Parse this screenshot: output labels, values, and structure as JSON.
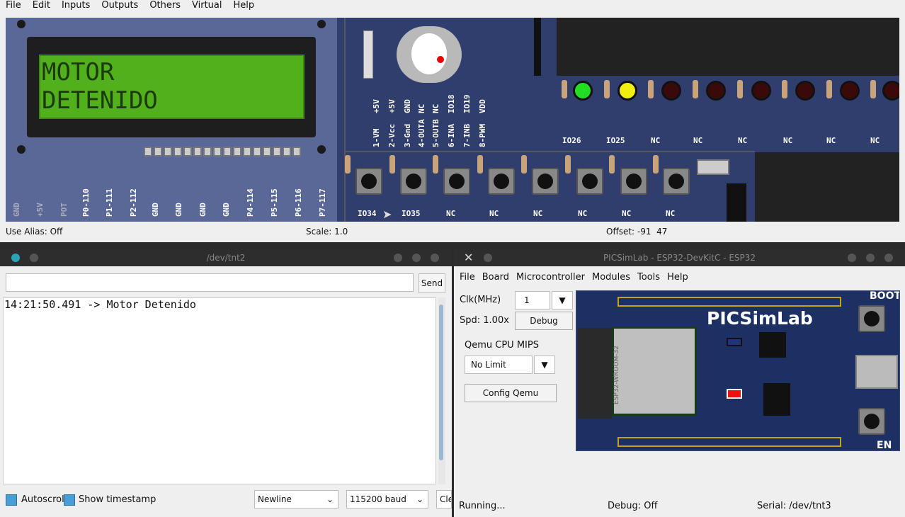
{
  "top": {
    "menu": [
      "File",
      "Edit",
      "Inputs",
      "Outputs",
      "Others",
      "Virtual",
      "Help"
    ],
    "lcd": {
      "line1": "MOTOR",
      "line2": "DETENIDO"
    },
    "lcd_pins": [
      "GND",
      "+5V",
      "POT",
      "P0-110",
      "P1-111",
      "P2-112",
      "GND",
      "GND",
      "GND",
      "GND",
      "P4-114",
      "P5-115",
      "P6-116",
      "P7-117"
    ],
    "driver_top": [
      "+5V",
      "+5V",
      "GND",
      "NC",
      "NC",
      "IO18",
      "IO19",
      "VDD"
    ],
    "driver_bottom": [
      "1-VM",
      "2-Vcc",
      "3-Gnd",
      "4-OUTA",
      "5-OUTB",
      "6-INA",
      "7-INB",
      "8-PWM"
    ],
    "led_labels": [
      "IO26",
      "IO25",
      "NC",
      "NC",
      "NC",
      "NC",
      "NC",
      "NC"
    ],
    "led_colors": [
      "#22dd22",
      "#f2ee10",
      "#3a0a0a",
      "#3a0a0a",
      "#3a0a0a",
      "#3a0a0a",
      "#3a0a0a",
      "#3a0a0a"
    ],
    "button_labels": [
      "IO34",
      "IO35",
      "NC",
      "NC",
      "NC",
      "NC",
      "NC",
      "NC"
    ],
    "status": {
      "alias": "Use Alias: Off",
      "scale": "Scale: 1.0",
      "offset": "Offset: -91  47"
    }
  },
  "serial": {
    "title": "/dev/tnt2",
    "send_label": "Send",
    "input_value": "",
    "console": "14:21:50.491 -> Motor Detenido",
    "autoscroll": "Autoscroll",
    "timestamp": "Show timestamp",
    "line_ending": "Newline",
    "baud": "115200 baud",
    "clear_label": "Cle"
  },
  "picsim": {
    "title": "PICSimLab - ESP32-DevKitC - ESP32",
    "menu": [
      "File",
      "Board",
      "Microcontroller",
      "Modules",
      "Tools",
      "Help"
    ],
    "clk_label": "Clk(MHz)",
    "clk_value": "1",
    "spd": "Spd: 1.00x",
    "debug_btn": "Debug",
    "qemu_label": "Qemu CPU MIPS",
    "qemu_value": "No Limit",
    "config_btn": "Config Qemu",
    "board_brand": "PICSimLab",
    "module_label": "ESP32-WROOM-32",
    "boot": "BOOT",
    "en": "EN",
    "status": {
      "running": "Running...",
      "debug": "Debug: Off",
      "serial": "Serial: /dev/tnt3"
    }
  }
}
